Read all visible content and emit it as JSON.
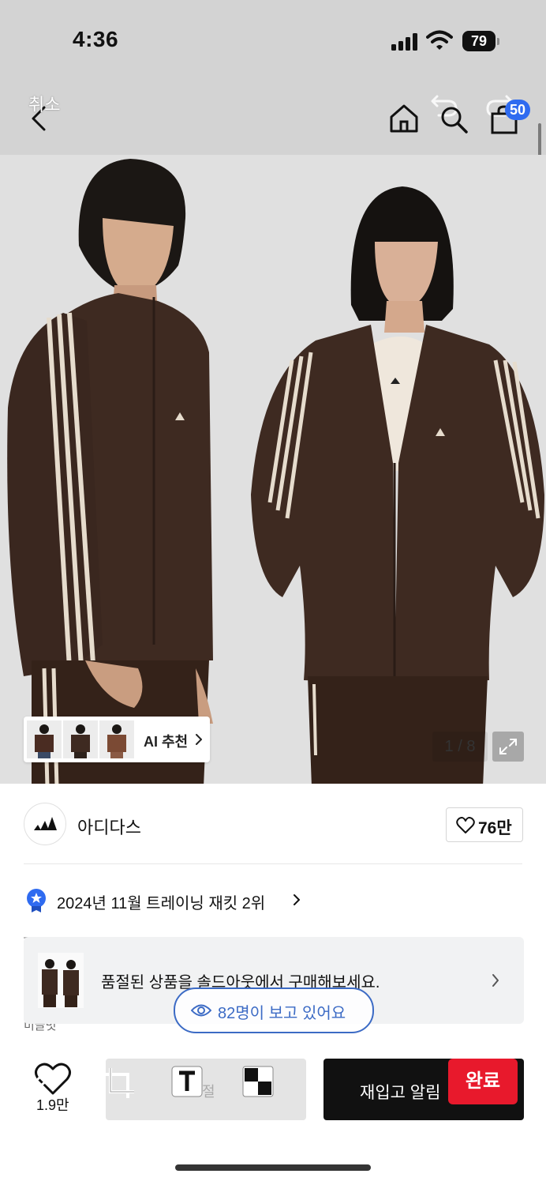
{
  "status_bar": {
    "time": "4:36",
    "battery": "79"
  },
  "edit_overlay": {
    "cancel_label": "취소",
    "done_label": "완료"
  },
  "header": {
    "cart_count": "50"
  },
  "gallery": {
    "ai_label": "AI 추천",
    "page_counter": "1 / 8"
  },
  "brand": {
    "name": "아디다스",
    "likes": "76만"
  },
  "ranking": {
    "text": "2024년 11월 트레이닝 재킷 2위"
  },
  "cutoff_text": "미끌벗",
  "soldout_banner": {
    "text": "품절된 상품을 솔드아웃에서 구매해보세요."
  },
  "viewers": {
    "text": "82명이 보고 있어요"
  },
  "bottom_bar": {
    "wish_count": "1.9만",
    "disabled_button_label": "절",
    "restock_label": "재입고 알림"
  },
  "colors": {
    "accent_blue": "#3c6bc5",
    "badge_blue": "#2f6bf0",
    "done_red": "#e8192c",
    "jacket_brown": "#3f2a22"
  }
}
